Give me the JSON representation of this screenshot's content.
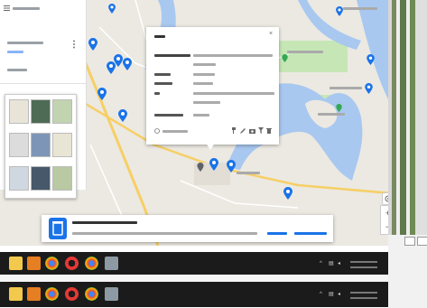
{
  "colors": {
    "map_land": "#ece9e2",
    "river": "#a8c8f0",
    "road_major": "#f6cf65",
    "road_minor": "#ffffff",
    "park": "#c6e7b5",
    "pin": "#1a73e8",
    "taskbar": "#1b1b1b",
    "notification_accent": "#1a73e8"
  },
  "left_panel": {
    "title": "",
    "subtitle": "",
    "layers_icon": "layers-icon",
    "thumbnails": [
      "map-style-default",
      "map-style-satellite",
      "map-style-terrain",
      "map-style-light",
      "map-style-dark",
      "map-style-atlas",
      "map-style-mono",
      "map-style-blue",
      "map-style-green"
    ]
  },
  "popup": {
    "title": "",
    "header_field": "",
    "rows": [
      {
        "label": "",
        "value": ""
      },
      {
        "label": "",
        "value": ""
      },
      {
        "label": "",
        "value": ""
      },
      {
        "label": "",
        "value": ""
      },
      {
        "label": "",
        "value": ""
      }
    ],
    "footer_link": "",
    "icons": [
      "paint-icon",
      "edit-icon",
      "camera-icon",
      "filter-icon",
      "delete-icon"
    ],
    "close_icon": "close-icon"
  },
  "map_controls": {
    "zoom_in": "+",
    "zoom_out": "−"
  },
  "notification": {
    "title": "",
    "body": "",
    "action_primary": "",
    "action_secondary": ""
  },
  "taskbar": {
    "apps": [
      "file-explorer-icon",
      "media-player-icon",
      "chrome-icon",
      "opera-icon",
      "chrome-icon-2",
      "app-icon"
    ],
    "tray_time": "",
    "tray_date": ""
  }
}
